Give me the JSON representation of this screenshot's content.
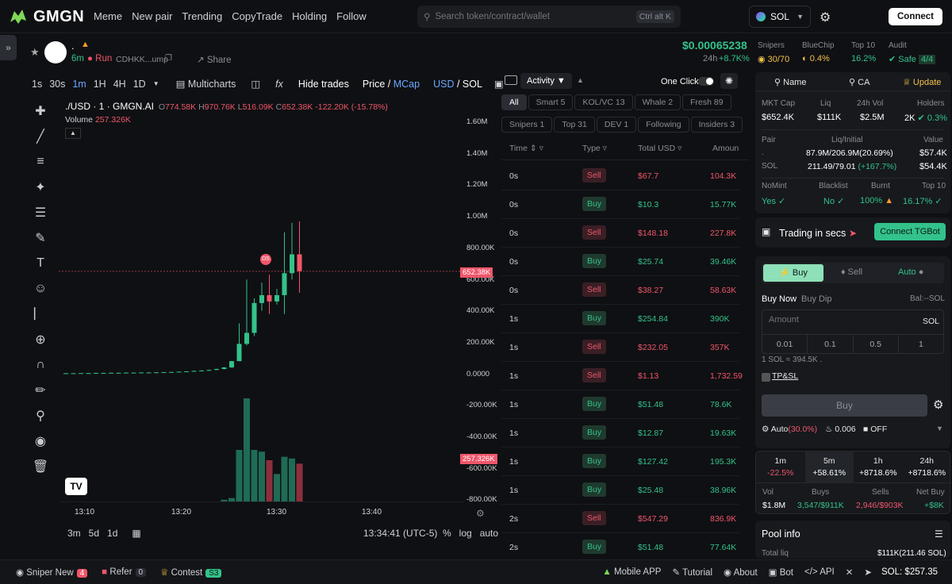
{
  "nav": {
    "brand": "GMGN",
    "links": [
      "Meme",
      "New pair",
      "Trending",
      "CopyTrade",
      "Holding",
      "Follow"
    ],
    "search_placeholder": "Search token/contract/wallet",
    "search_shortcut": "Ctrl alt K",
    "chain": "SOL",
    "connect_label": "Connect"
  },
  "token": {
    "name": ".",
    "age": "6m",
    "run": "Run",
    "contract": "CDHKK...ump",
    "share": "Share",
    "price": "$0.00065238",
    "change_label": "24h",
    "change": "+8.7K%",
    "stats": [
      {
        "label": "Snipers",
        "value": "30/70"
      },
      {
        "label": "BlueChip",
        "value": "0.4%"
      },
      {
        "label": "Top 10",
        "value": "16.2%"
      },
      {
        "label": "Audit",
        "value": "Safe",
        "extra": "4/4"
      }
    ]
  },
  "chart_toolbar": {
    "timeframes": [
      "1s",
      "30s",
      "1m",
      "1H",
      "4H",
      "1D"
    ],
    "active_timeframe": "1m",
    "multicharts": "Multicharts",
    "hide_trades": "Hide trades",
    "price": "Price",
    "mcap": "MCap",
    "usd": "USD",
    "sol": "SOL"
  },
  "ohlc": {
    "symbol": "./USD · 1 · GMGN.AI",
    "o": "774.58K",
    "h": "970.76K",
    "l": "516.09K",
    "c": "652.38K",
    "chg": "-122.20K (-15.78%)",
    "volume_label": "Volume",
    "volume": "257.326K"
  },
  "chart_data": {
    "type": "candlestick",
    "y_ticks": [
      "1.60M",
      "1.40M",
      "1.20M",
      "1.00M",
      "800.00K",
      "600.00K",
      "400.00K",
      "200.00K",
      "0.0000",
      "-200.00K",
      "-400.00K",
      "-600.00K",
      "-800.00K"
    ],
    "x_ticks": [
      "13:10",
      "13:20",
      "13:30",
      "13:40"
    ],
    "last_price_tag": "652.38K",
    "volume_tag": "257.326K",
    "marker": "DS",
    "candles": [
      {
        "o": 2,
        "c": 3,
        "h": 4,
        "l": 1,
        "v": 0
      },
      {
        "o": 3,
        "c": 3,
        "h": 4,
        "l": 2,
        "v": 0
      },
      {
        "o": 3,
        "c": 4,
        "h": 5,
        "l": 2,
        "v": 0
      },
      {
        "o": 4,
        "c": 4,
        "h": 5,
        "l": 3,
        "v": 0
      },
      {
        "o": 4,
        "c": 5,
        "h": 6,
        "l": 3,
        "v": 0
      },
      {
        "o": 5,
        "c": 5,
        "h": 6,
        "l": 4,
        "v": 0
      },
      {
        "o": 5,
        "c": 6,
        "h": 7,
        "l": 4,
        "v": 0
      },
      {
        "o": 6,
        "c": 6,
        "h": 7,
        "l": 5,
        "v": 0
      },
      {
        "o": 6,
        "c": 7,
        "h": 8,
        "l": 5,
        "v": 0
      },
      {
        "o": 7,
        "c": 7,
        "h": 8,
        "l": 6,
        "v": 0
      },
      {
        "o": 7,
        "c": 8,
        "h": 9,
        "l": 6,
        "v": 0
      },
      {
        "o": 8,
        "c": 8,
        "h": 9,
        "l": 7,
        "v": 0
      },
      {
        "o": 8,
        "c": 9,
        "h": 10,
        "l": 7,
        "v": 0
      },
      {
        "o": 9,
        "c": 10,
        "h": 11,
        "l": 8,
        "v": 0
      },
      {
        "o": 10,
        "c": 11,
        "h": 12,
        "l": 9,
        "v": 0
      },
      {
        "o": 11,
        "c": 13,
        "h": 14,
        "l": 10,
        "v": 0
      },
      {
        "o": 13,
        "c": 15,
        "h": 16,
        "l": 12,
        "v": 0
      },
      {
        "o": 15,
        "c": 18,
        "h": 20,
        "l": 14,
        "v": 0
      },
      {
        "o": 18,
        "c": 20,
        "h": 22,
        "l": 17,
        "v": 0
      },
      {
        "o": 20,
        "c": 24,
        "h": 26,
        "l": 19,
        "v": 0
      },
      {
        "o": 24,
        "c": 30,
        "h": 32,
        "l": 23,
        "v": 0
      },
      {
        "o": 30,
        "c": 40,
        "h": 42,
        "l": 28,
        "v": 2
      },
      {
        "o": 40,
        "c": 80,
        "h": 82,
        "l": 38,
        "v": 4
      },
      {
        "o": 80,
        "c": 190,
        "h": 320,
        "l": 80,
        "v": 60
      },
      {
        "o": 190,
        "c": 260,
        "h": 600,
        "l": 180,
        "v": 120
      },
      {
        "o": 260,
        "c": 450,
        "h": 480,
        "l": 240,
        "v": 60
      },
      {
        "o": 450,
        "c": 500,
        "h": 580,
        "l": 400,
        "v": 58
      },
      {
        "o": 500,
        "c": 460,
        "h": 630,
        "l": 380,
        "v": 48
      },
      {
        "o": 460,
        "c": 500,
        "h": 540,
        "l": 440,
        "v": 32
      },
      {
        "o": 500,
        "c": 640,
        "h": 900,
        "l": 380,
        "v": 52
      },
      {
        "o": 640,
        "c": 760,
        "h": 960,
        "l": 600,
        "v": 50
      },
      {
        "o": 760,
        "c": 653,
        "h": 970,
        "l": 516,
        "v": 44
      }
    ]
  },
  "range_buttons": [
    "3m",
    "5d",
    "1d"
  ],
  "time_display": "13:34:41 (UTC-5)",
  "axis_modes": [
    "%",
    "log",
    "auto"
  ],
  "activity": {
    "tab": "Activity",
    "one_click": "One Click",
    "filters_row1": [
      "All",
      "Smart 5",
      "KOL/VC 13",
      "Whale 2",
      "Fresh 89"
    ],
    "filters_row2": [
      "Snipers 1",
      "Top 31",
      "DEV 1",
      "Following",
      "Insiders 3"
    ],
    "headers": [
      "Time",
      "Type",
      "Total USD",
      "Amoun"
    ],
    "rows": [
      {
        "t": "0s",
        "type": "Sell",
        "usd": "$67.7",
        "amt": "104.3K"
      },
      {
        "t": "0s",
        "type": "Buy",
        "usd": "$10.3",
        "amt": "15.77K"
      },
      {
        "t": "0s",
        "type": "Sell",
        "usd": "$148.18",
        "amt": "227.8K"
      },
      {
        "t": "0s",
        "type": "Buy",
        "usd": "$25.74",
        "amt": "39.46K"
      },
      {
        "t": "0s",
        "type": "Sell",
        "usd": "$38.27",
        "amt": "58.63K"
      },
      {
        "t": "1s",
        "type": "Buy",
        "usd": "$254.84",
        "amt": "390K"
      },
      {
        "t": "1s",
        "type": "Sell",
        "usd": "$232.05",
        "amt": "357K"
      },
      {
        "t": "1s",
        "type": "Sell",
        "usd": "$1.13",
        "amt": "1,732.59"
      },
      {
        "t": "1s",
        "type": "Buy",
        "usd": "$51.48",
        "amt": "78.6K"
      },
      {
        "t": "1s",
        "type": "Buy",
        "usd": "$12.87",
        "amt": "19.63K"
      },
      {
        "t": "1s",
        "type": "Buy",
        "usd": "$127.42",
        "amt": "195.3K"
      },
      {
        "t": "1s",
        "type": "Buy",
        "usd": "$25.48",
        "amt": "38.96K"
      },
      {
        "t": "2s",
        "type": "Sell",
        "usd": "$547.29",
        "amt": "836.9K"
      },
      {
        "t": "2s",
        "type": "Buy",
        "usd": "$51.48",
        "amt": "77.64K"
      }
    ]
  },
  "info": {
    "tabs": [
      "Name",
      "CA",
      "Update"
    ],
    "mkt": [
      {
        "label": "MKT Cap",
        "value": "$652.4K"
      },
      {
        "label": "Liq",
        "value": "$111K"
      },
      {
        "label": "24h Vol",
        "value": "$2.5M"
      },
      {
        "label": "Holders",
        "value": "2K",
        "extra": "0.3%"
      }
    ],
    "pair_label": "Pair",
    "liq_initial_label": "Liq/Initial",
    "value_label": "Value",
    "pair_row1": {
      "name": ".",
      "liq": "87.9M/206.9M(20.69%)",
      "value": "$57.4K"
    },
    "pair_row2": {
      "name": "SOL",
      "liq": "211.49/79.01",
      "pct": "(+167.7%)",
      "value": "$54.4K"
    },
    "flags": [
      {
        "label": "NoMint",
        "value": "Yes"
      },
      {
        "label": "Blacklist",
        "value": "No"
      },
      {
        "label": "Burnt",
        "value": "100%"
      },
      {
        "label": "Top 10",
        "value": "16.17%"
      }
    ],
    "trading_secs": "Trading in secs",
    "connect_tg": "Connect TGBot"
  },
  "trade": {
    "tabs": [
      "Buy",
      "Sell",
      "Auto"
    ],
    "buy_now": "Buy Now",
    "buy_dip": "Buy Dip",
    "bal": "Bal:--SOL",
    "amount_placeholder": "Amount",
    "unit": "SOL",
    "presets": [
      "0.01",
      "0.1",
      "0.5",
      "1"
    ],
    "rate": "1 SOL ≈ 394.5K .",
    "tpsl": "TP&SL",
    "buy_btn": "Buy",
    "auto": "Auto",
    "auto_pct": "(30.0%)",
    "fee": "0.006",
    "off": "OFF"
  },
  "periods": [
    {
      "label": "1m",
      "value": "-22.5%"
    },
    {
      "label": "5m",
      "value": "+58.61%"
    },
    {
      "label": "1h",
      "value": "+8718.6%"
    },
    {
      "label": "24h",
      "value": "+8718.6%"
    }
  ],
  "vol_stats": {
    "vol_label": "Vol",
    "vol": "$1.8M",
    "buys_label": "Buys",
    "buys": "3,547/$911K",
    "sells_label": "Sells",
    "sells": "2,946/$903K",
    "net_label": "Net Buy",
    "net": "+$8K"
  },
  "pool": {
    "title": "Pool info",
    "total_liq_label": "Total liq",
    "total_liq": "$111K(211.46 SOL)"
  },
  "bottom": {
    "sniper": "Sniper New",
    "sniper_n": "4",
    "refer": "Refer",
    "refer_n": "0",
    "contest": "Contest",
    "contest_n": "S3",
    "mobile": "Mobile APP",
    "tutorial": "Tutorial",
    "about": "About",
    "bot": "Bot",
    "api": "API",
    "sol_price": "SOL: $257.35"
  }
}
